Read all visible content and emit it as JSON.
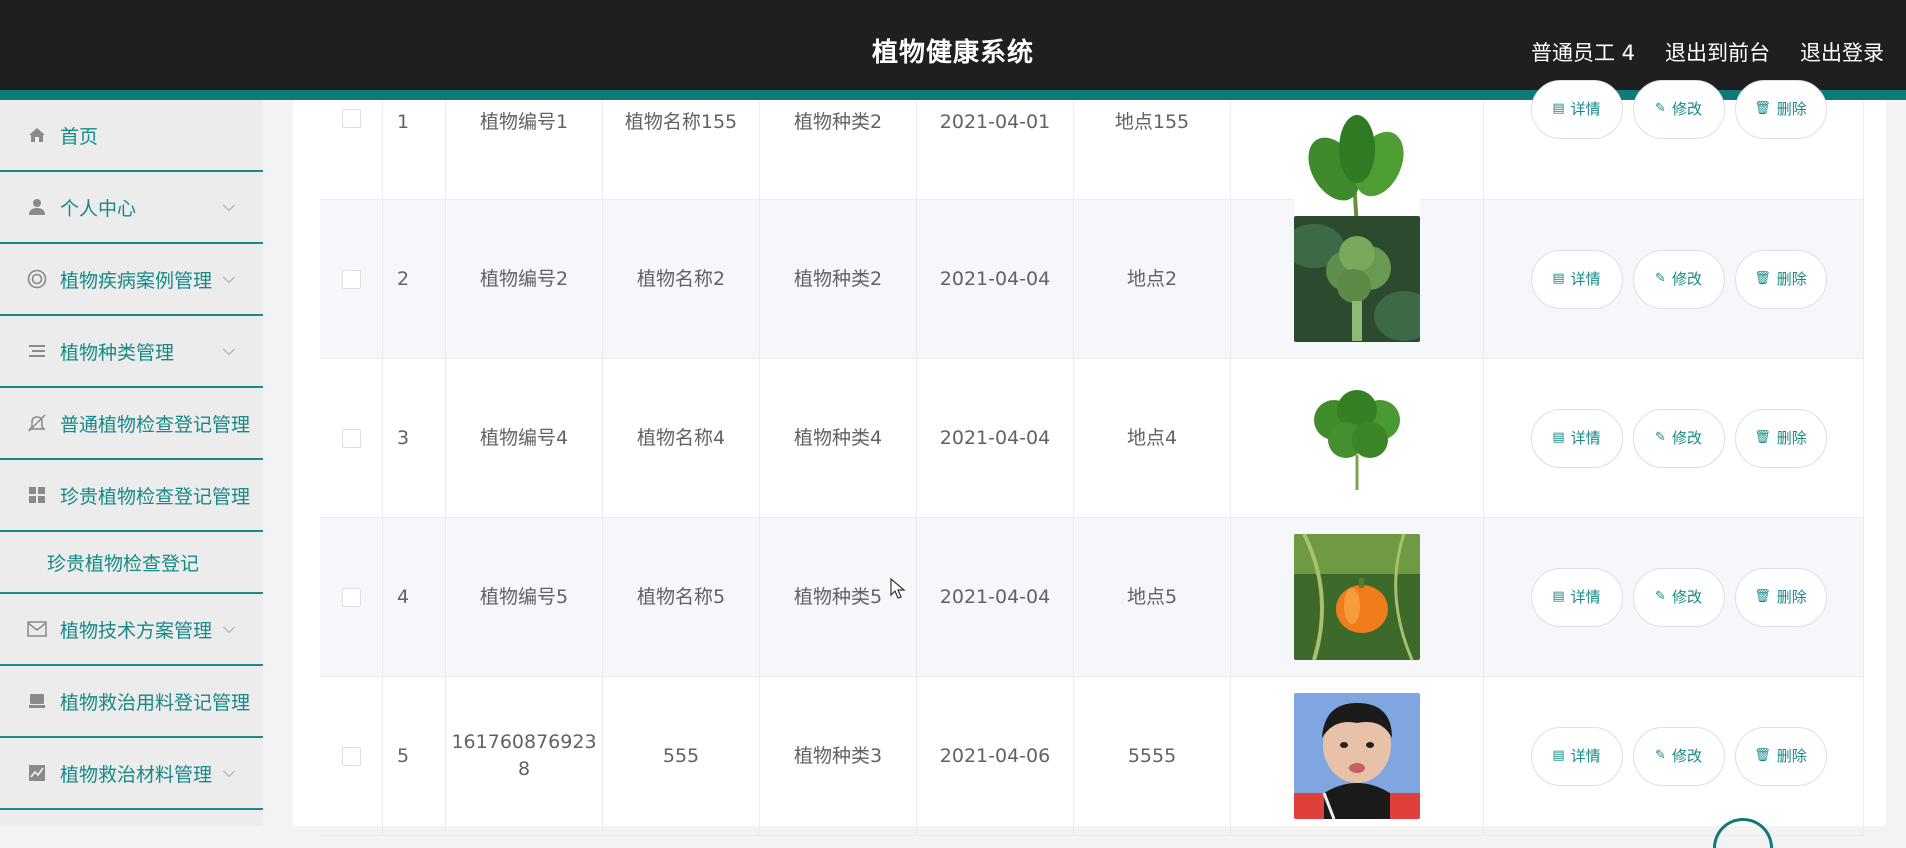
{
  "app": {
    "title": "植物健康系统",
    "user_label": "普通员工 4",
    "front_link": "退出到前台",
    "logout_link": "退出登录"
  },
  "sidebar": {
    "items": [
      {
        "label": "首页",
        "icon": "home-icon",
        "chevron": false
      },
      {
        "label": "个人中心",
        "icon": "user-icon",
        "chevron": true
      },
      {
        "label": "植物疾病案例管理",
        "icon": "target-icon",
        "chevron": true
      },
      {
        "label": "植物种类管理",
        "icon": "list-icon",
        "chevron": true
      },
      {
        "label": "普通植物检查登记管理",
        "icon": "bell-off-icon",
        "chevron": false
      },
      {
        "label": "珍贵植物检查登记管理",
        "icon": "grid-icon",
        "chevron": false
      },
      {
        "label": "珍贵植物检查登记",
        "sub": true
      },
      {
        "label": "植物技术方案管理",
        "icon": "mail-icon",
        "chevron": true
      },
      {
        "label": "植物救治用料登记管理",
        "icon": "printer-icon",
        "chevron": false
      },
      {
        "label": "植物救治材料管理",
        "icon": "chart-icon",
        "chevron": true
      }
    ]
  },
  "table": {
    "rows": [
      {
        "idx": "1",
        "num": "植物编号1",
        "name": "植物名称155",
        "type": "植物种类2",
        "date": "2021-04-01",
        "loc": "地点155",
        "image": "leafy-greens"
      },
      {
        "idx": "2",
        "num": "植物编号2",
        "name": "植物名称2",
        "type": "植物种类2",
        "date": "2021-04-04",
        "loc": "地点2",
        "image": "broccoli"
      },
      {
        "idx": "3",
        "num": "植物编号4",
        "name": "植物名称4",
        "type": "植物种类4",
        "date": "2021-04-04",
        "loc": "地点4",
        "image": "parsley"
      },
      {
        "idx": "4",
        "num": "植物编号5",
        "name": "植物名称5",
        "type": "植物种类5",
        "date": "2021-04-04",
        "loc": "地点5",
        "image": "pumpkin"
      },
      {
        "idx": "5",
        "num": "161760876923\n8",
        "name": "555",
        "type": "植物种类3",
        "date": "2021-04-06",
        "loc": "5555",
        "image": "person-photo"
      }
    ],
    "ops": {
      "detail": "详情",
      "edit": "修改",
      "delete": "删除"
    }
  },
  "colors": {
    "accent": "#178a86",
    "topbar": "#1f1f1f"
  }
}
